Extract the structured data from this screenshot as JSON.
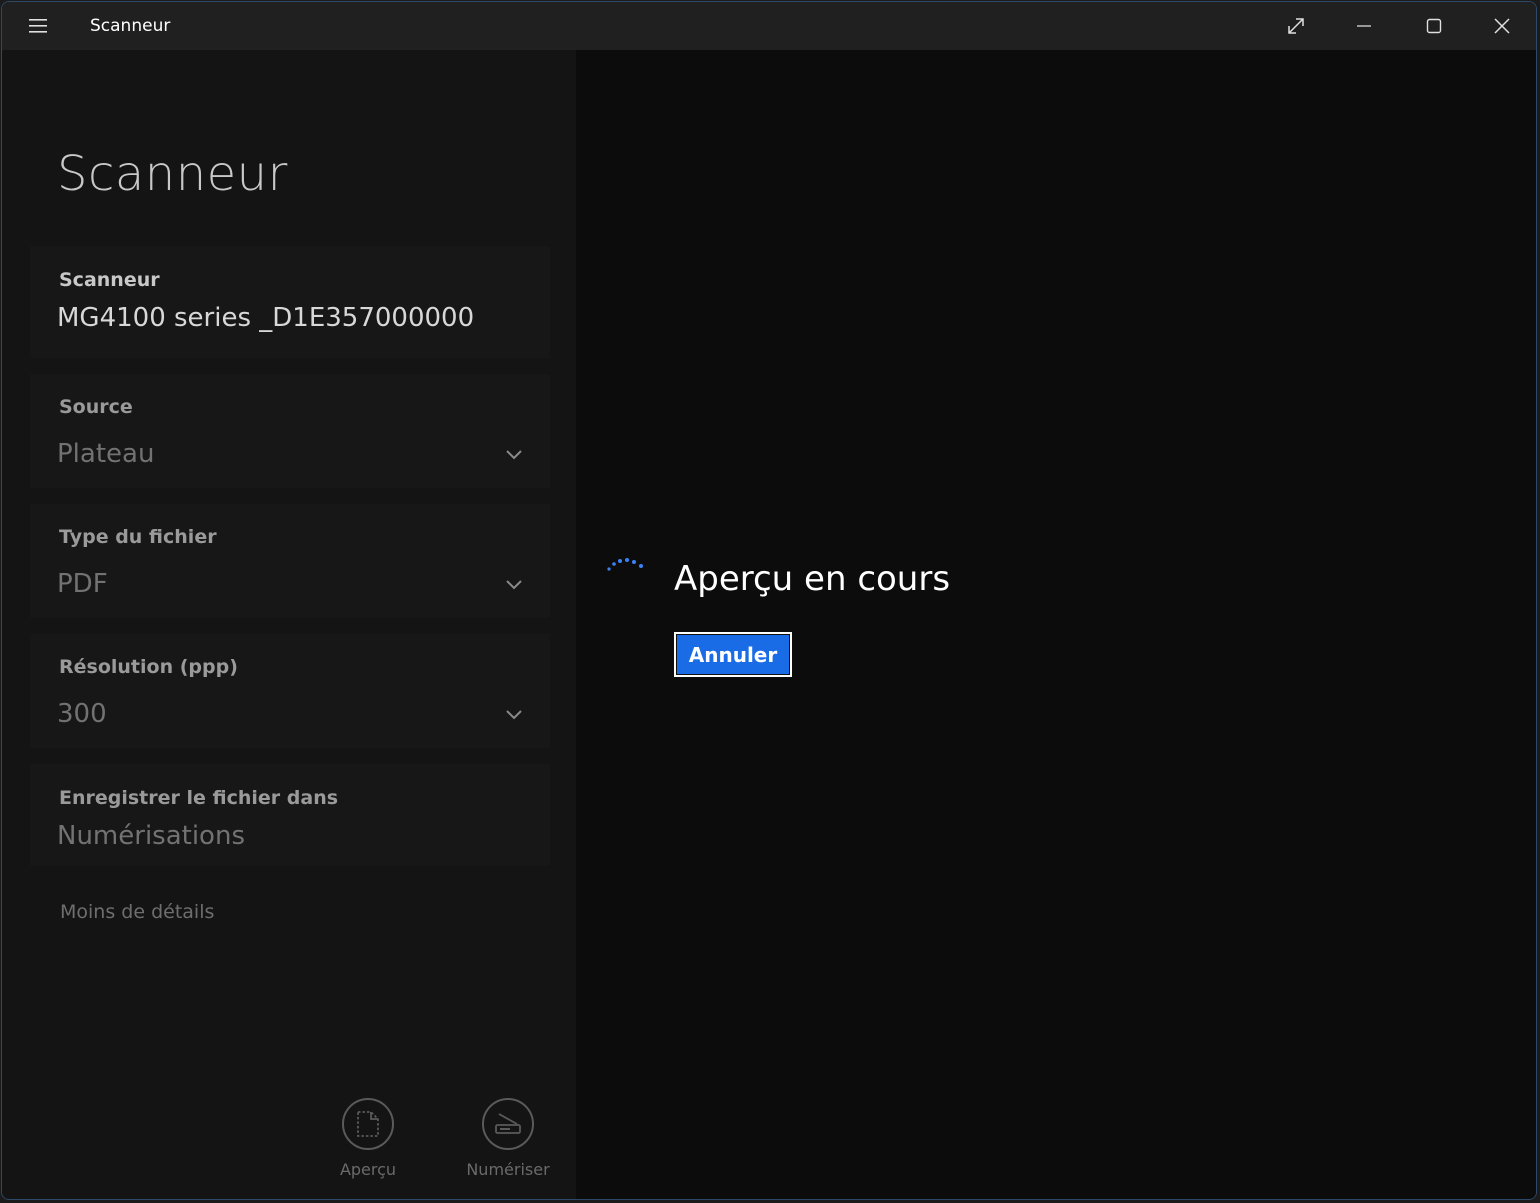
{
  "window": {
    "title": "Scanneur",
    "controls": [
      "fullscreen-icon",
      "minimize-icon",
      "maximize-icon",
      "close-icon"
    ]
  },
  "sidebar": {
    "heading": "Scanneur",
    "fields": [
      {
        "label": "Scanneur",
        "value": "MG4100 series _D1E357000000",
        "dropdown": false
      },
      {
        "label": "Source",
        "value": "Plateau",
        "dropdown": true
      },
      {
        "label": "Type du fichier",
        "value": "PDF",
        "dropdown": true
      },
      {
        "label": "Résolution (ppp)",
        "value": "300",
        "dropdown": true
      },
      {
        "label": "Enregistrer le fichier dans",
        "value": "Numérisations",
        "dropdown": false
      }
    ],
    "less_details": "Moins de détails",
    "actions": {
      "preview_label": "Aperçu",
      "scan_label": "Numériser"
    }
  },
  "main": {
    "status_text": "Aperçu en cours",
    "cancel_label": "Annuler"
  },
  "colors": {
    "accent": "#1a6ce6",
    "spinner": "#3b82f6"
  }
}
